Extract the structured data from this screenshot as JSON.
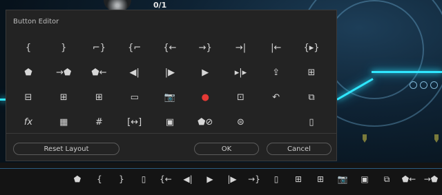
{
  "window": {
    "counter": "0/1"
  },
  "dialog": {
    "title": "Button Editor",
    "rows": [
      [
        {
          "glyph": "{",
          "name": "mark-in-icon"
        },
        {
          "glyph": "}",
          "name": "mark-out-icon"
        },
        {
          "glyph": "⌐}",
          "name": "mark-clip-icon"
        },
        {
          "glyph": "{⌐",
          "name": "go-to-in-icon"
        },
        {
          "glyph": "{←",
          "name": "go-to-previous-edit-icon"
        },
        {
          "glyph": "→}",
          "name": "go-to-next-edit-icon"
        },
        {
          "glyph": "→|",
          "name": "go-to-out-icon"
        },
        {
          "glyph": "|←",
          "name": "go-to-in-point-icon"
        },
        {
          "glyph": "{▸}",
          "name": "play-in-to-out-icon"
        }
      ],
      [
        {
          "glyph": "⬟",
          "name": "add-marker-icon"
        },
        {
          "glyph": "→⬟",
          "name": "go-to-next-marker-icon"
        },
        {
          "glyph": "⬟←",
          "name": "go-to-previous-marker-icon"
        },
        {
          "glyph": "◀|",
          "name": "step-back-icon"
        },
        {
          "glyph": "|▶",
          "name": "step-forward-icon"
        },
        {
          "glyph": "▶",
          "name": "play-icon"
        },
        {
          "glyph": "▸|▸",
          "name": "play-around-icon"
        },
        {
          "glyph": "⇪",
          "name": "lift-icon"
        },
        {
          "glyph": "⊞",
          "name": "extract-icon"
        }
      ],
      [
        {
          "glyph": "⊟",
          "name": "insert-icon"
        },
        {
          "glyph": "⊞",
          "name": "overwrite-icon"
        },
        {
          "glyph": "⊞",
          "name": "replace-icon"
        },
        {
          "glyph": "▭",
          "name": "safe-margins-icon"
        },
        {
          "glyph": "📷",
          "name": "export-frame-icon"
        },
        {
          "glyph": "●",
          "name": "record-icon"
        },
        {
          "glyph": "⊡",
          "name": "multi-camera-icon"
        },
        {
          "glyph": "↶",
          "name": "loop-icon"
        },
        {
          "glyph": "⧉",
          "name": "comparison-view-icon"
        }
      ],
      [
        {
          "glyph": "fx",
          "name": "global-fx-mute-icon"
        },
        {
          "glyph": "▦",
          "name": "ruler-icon"
        },
        {
          "glyph": "#",
          "name": "grid-icon"
        },
        {
          "glyph": "[↔]",
          "name": "trim-icon"
        },
        {
          "glyph": "▣",
          "name": "toggle-proxies-icon"
        },
        {
          "glyph": "⬟⊘",
          "name": "clear-markers-icon"
        },
        {
          "glyph": "⊜",
          "name": "vr-video-icon"
        },
        {
          "glyph": "",
          "name": "blank-icon"
        },
        {
          "glyph": "▯",
          "name": "spacer-icon"
        }
      ]
    ],
    "reset_label": "Reset Layout",
    "ok_label": "OK",
    "cancel_label": "Cancel"
  },
  "transport": [
    {
      "glyph": "⬟",
      "name": "add-marker-icon"
    },
    {
      "glyph": "{",
      "name": "mark-in-icon"
    },
    {
      "glyph": "}",
      "name": "mark-out-icon"
    },
    {
      "glyph": "▯",
      "name": "spacer-icon"
    },
    {
      "glyph": "{←",
      "name": "go-to-in-icon"
    },
    {
      "glyph": "◀|",
      "name": "step-back-icon"
    },
    {
      "glyph": "▶",
      "name": "play-icon"
    },
    {
      "glyph": "|▶",
      "name": "step-forward-icon"
    },
    {
      "glyph": "→}",
      "name": "go-to-out-icon"
    },
    {
      "glyph": "▯",
      "name": "spacer-icon"
    },
    {
      "glyph": "⊞",
      "name": "insert-icon"
    },
    {
      "glyph": "⊞",
      "name": "overwrite-icon"
    },
    {
      "glyph": "📷",
      "name": "export-frame-icon"
    },
    {
      "glyph": "▣",
      "name": "toggle-proxies-icon"
    },
    {
      "glyph": "⧉",
      "name": "comparison-view-icon"
    },
    {
      "glyph": "⬟←",
      "name": "go-to-previous-marker-icon"
    },
    {
      "glyph": "→⬟",
      "name": "go-to-next-marker-icon"
    }
  ],
  "colors": {
    "accent": "#2fe7ff",
    "record": "#e53935",
    "dialog_bg": "#232323"
  }
}
